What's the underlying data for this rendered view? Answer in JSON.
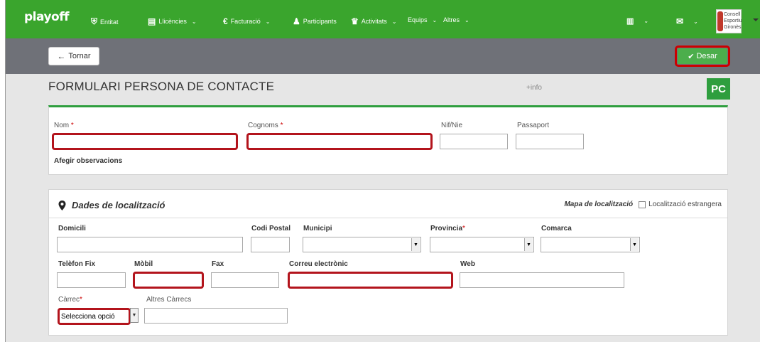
{
  "nav": {
    "brand": "playoff",
    "items": [
      {
        "icon": "shield-icon",
        "glyph": "⛨",
        "label": "Entitat",
        "chevron": false
      },
      {
        "icon": "id-card-icon",
        "glyph": "▤",
        "label": "Llicències",
        "chevron": true
      },
      {
        "icon": "euro-icon",
        "glyph": "€",
        "label": "Facturació",
        "chevron": true
      },
      {
        "icon": "user-icon",
        "glyph": "♟",
        "label": "Participants",
        "chevron": false
      },
      {
        "icon": "trophy-icon",
        "glyph": "🏆",
        "label": "Activitats",
        "chevron": true
      },
      {
        "icon": "",
        "glyph": "",
        "label": "Equips",
        "chevron": true
      },
      {
        "icon": "",
        "glyph": "",
        "label": "Altres",
        "chevron": true
      }
    ],
    "logo_text": [
      "Consell",
      "Esportiu",
      "Gironès"
    ]
  },
  "toolbar": {
    "back_label": "Tornar",
    "save_label": "Desar"
  },
  "header": {
    "title": "FORMULARI PERSONA DE CONTACTE",
    "plus_info": "+info",
    "badge": "PC"
  },
  "identity": {
    "nom_label": "Nom",
    "cognoms_label": "Cognoms",
    "nif_label": "Nif/Nie",
    "passaport_label": "Passaport",
    "required_mark": "*",
    "observations_link": "Afegir observacions"
  },
  "location": {
    "section_title": "Dades de localització",
    "map_label": "Mapa de localització",
    "foreign_label": "Localització estrangera",
    "domicili_label": "Domicili",
    "codi_postal_label": "Codi Postal",
    "municipi_label": "Municipi",
    "provincia_label": "Provincia",
    "comarca_label": "Comarca",
    "telefon_label": "Telèfon Fix",
    "mobil_label": "Mòbil",
    "fax_label": "Fax",
    "email_label": "Correu electrònic",
    "web_label": "Web",
    "carrec_label": "Càrrec",
    "carrec_value": "Selecciona opció",
    "altres_carrecs_label": "Altres Càrrecs"
  }
}
